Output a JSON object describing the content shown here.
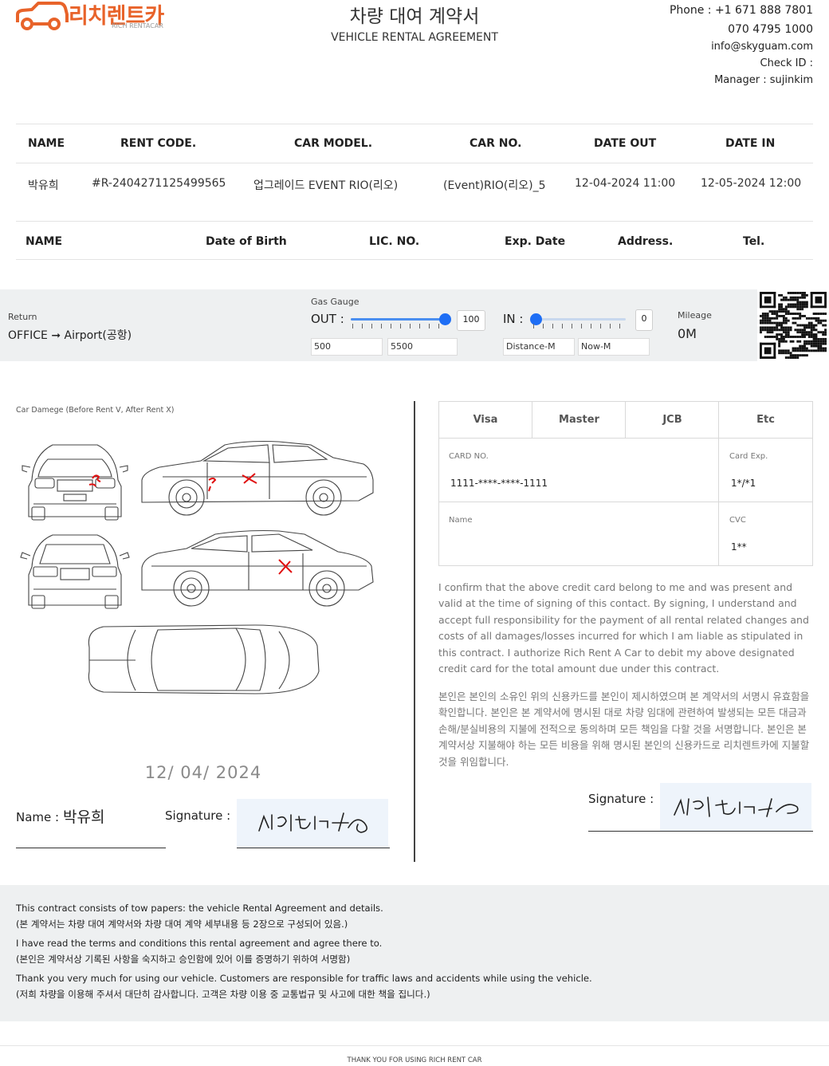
{
  "header": {
    "logo_text": "리치렌트카",
    "logo_sub": "RICH RENTACAR",
    "title_ko": "차량 대여 계약서",
    "title_en": "VEHICLE RENTAL AGREEMENT",
    "phone_label": "Phone : +1 671 888 7801",
    "phone2": "070 4795 1000",
    "email": "info@skyguam.com",
    "check_id": "Check ID :",
    "manager": "Manager : sujinkim"
  },
  "rental_table": {
    "headers": [
      "NAME",
      "RENT CODE.",
      "CAR MODEL.",
      "CAR NO.",
      "DATE OUT",
      "DATE IN"
    ],
    "row": [
      "박유희",
      "#R-2404271125499565",
      "업그레이드 EVENT RIO(리오)",
      "(Event)RIO(리오)_5",
      "12-04-2024 11:00",
      "12-05-2024 12:00"
    ]
  },
  "driver_table": {
    "headers": [
      "NAME",
      "Date of Birth",
      "LIC. NO.",
      "Exp. Date",
      "Address.",
      "Tel."
    ]
  },
  "gas": {
    "return_label": "Return",
    "return_route": "OFFICE ➞ Airport(공항)",
    "gauge_label": "Gas Gauge",
    "out_label": "OUT :",
    "out_value": "100",
    "out_level": 1.0,
    "out_box1": "500",
    "out_box2": "5500",
    "in_label": "IN :",
    "in_value": "0",
    "in_level": 0.0,
    "in_box1": "Distance-M",
    "in_box2": "Now-M",
    "mileage_label": "Mileage",
    "mileage_value": "0M"
  },
  "damage": {
    "caption": "Car Damege (Before Rent V, After Rent X)",
    "date": "12/ 04/ 2024",
    "name_label": "Name :",
    "name_value": "박유희",
    "signature_label": "Signature :",
    "signature_text": "서명완료"
  },
  "card": {
    "brands": [
      "Visa",
      "Master",
      "JCB",
      "Etc"
    ],
    "card_no_label": "CARD NO.",
    "card_no": "1111-****-****-1111",
    "card_exp_label": "Card Exp.",
    "card_exp": "1*/*1",
    "name_label": "Name",
    "cvc_label": "CVC",
    "cvc": "1**",
    "confirm_en": "I confirm that the above credit card belong to me and was present and valid at the time of signing of this contact. By signing, I understand and accept full responsibility for the payment of all rental related changes and costs of all damages/losses incurred for which I am liable as stipulated in this contract. I authorize Rich Rent A Car to debit my above designated credit card for the total amount due under this contract.",
    "confirm_ko": "본인은 본인의 소유인 위의 신용카드를 본인이 제시하였으며 본 계약서의 서명시 유효함을 확인합니다. 본인은 본 계약서에 명시된 대로 차량 임대에 관련하여 발생되는 모든 대금과 손해/분실비용의 지불에 전적으로 동의하며 모든 책임을 다할 것을 서명합니다. 본인은 본 계약서상 지불해야 하는 모든 비용을 위해 명시된 본인의 신용카드로 리치렌트카에 지불할 것을 위임합니다.",
    "signature_label": "Signature :",
    "signature_text": "서명완료"
  },
  "footer": {
    "lines": [
      "This contract consists of tow papers: the vehicle Rental Agreement and details.",
      "(본 계약서는 차량 대여 계약서와 차량 대여 계약 세부내용 등 2장으로 구성되어 있음.)",
      "I have read the terms and conditions this rental agreement and agree there to.",
      "(본인은 계약서상 기록된 사항을 숙지하고 승인함에 있어 이를 증명하기 위하여 서명함)",
      "Thank you very much for using our vehicle. Customers are responsible for traffic laws and accidents while using the vehicle.",
      "(저희 차량을 이용해 주셔서 대단히 감사합니다. 고객은 차량 이용 중 교통법규 및 사고에 대한 책을 집니다.)"
    ],
    "thanks": "THANK YOU FOR USING RICH RENT CAR"
  },
  "colors": {
    "brand": "#e8632a",
    "slider": "#1e6ef5",
    "band": "#eef0f1",
    "damage_mark": "#e01010"
  }
}
